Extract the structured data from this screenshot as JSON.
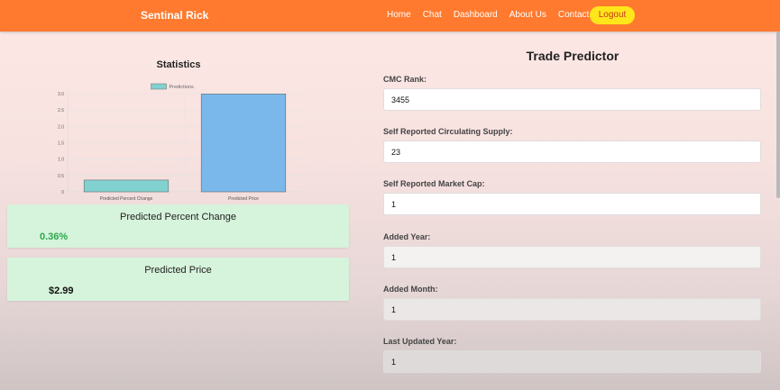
{
  "navbar": {
    "brand": "Sentinal Rick",
    "links": [
      "Home",
      "Chat",
      "Dashboard",
      "About Us",
      "Contact"
    ],
    "logout_label": "Logout"
  },
  "statistics": {
    "title": "Statistics"
  },
  "chart_data": {
    "type": "bar",
    "categories": [
      "Predicted Percent Change",
      "Predicted Price"
    ],
    "series": [
      {
        "name": "Predictions",
        "values": [
          0.36,
          2.99
        ]
      }
    ],
    "ylim": [
      0,
      3.0
    ],
    "yticks": [
      "0",
      "0.5",
      "1.0",
      "1.5",
      "2.0",
      "2.5",
      "3.0"
    ],
    "legend": "top-center",
    "grid": true,
    "colors": [
      "#82d1d1",
      "#7ab8eb"
    ]
  },
  "cards": {
    "percent": {
      "title": "Predicted Percent Change",
      "value": "0.36%"
    },
    "price": {
      "title": "Predicted Price",
      "value": "$2.99"
    }
  },
  "form": {
    "title": "Trade Predictor",
    "fields": [
      {
        "label": "CMC Rank:",
        "value": "3455"
      },
      {
        "label": "Self Reported Circulating Supply:",
        "value": "23"
      },
      {
        "label": "Self Reported Market Cap:",
        "value": "1"
      },
      {
        "label": "Added Year:",
        "value": "1"
      },
      {
        "label": "Added Month:",
        "value": "1"
      },
      {
        "label": "Last Updated Year:",
        "value": "1"
      }
    ]
  }
}
